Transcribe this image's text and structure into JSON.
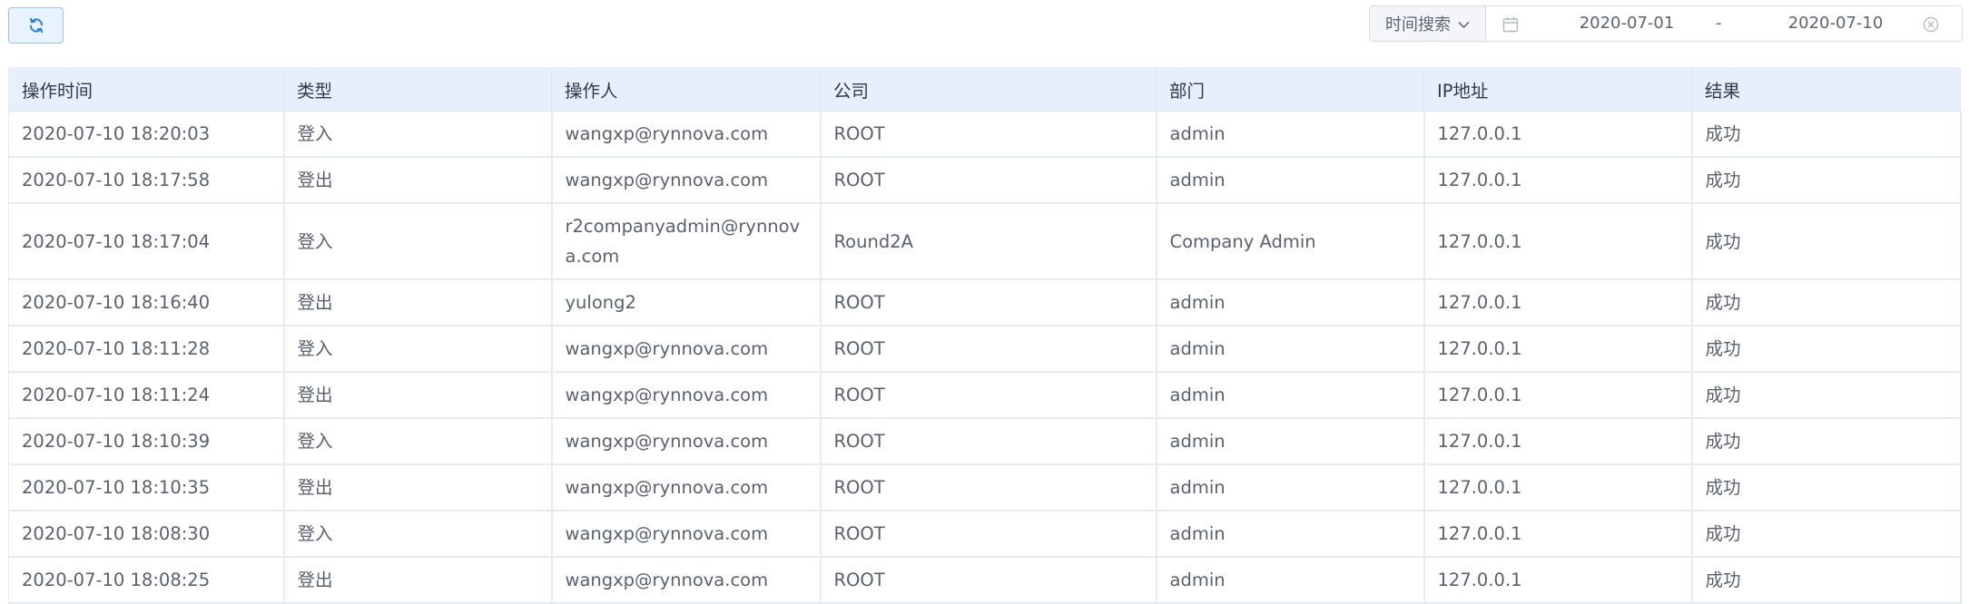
{
  "toolbar": {
    "refresh_icon": "refresh-icon",
    "search_type_label": "时间搜索",
    "date_start": "2020-07-01",
    "date_separator": "-",
    "date_end": "2020-07-10",
    "calendar_icon": "calendar-icon",
    "clear_icon": "circle-close-icon"
  },
  "table": {
    "columns": [
      "操作时间",
      "类型",
      "操作人",
      "公司",
      "部门",
      "IP地址",
      "结果"
    ],
    "rows": [
      [
        "2020-07-10 18:20:03",
        "登入",
        "wangxp@rynnova.com",
        "ROOT",
        "admin",
        "127.0.0.1",
        "成功"
      ],
      [
        "2020-07-10 18:17:58",
        "登出",
        "wangxp@rynnova.com",
        "ROOT",
        "admin",
        "127.0.0.1",
        "成功"
      ],
      [
        "2020-07-10 18:17:04",
        "登入",
        "r2companyadmin@rynnova.com",
        "Round2A",
        "Company Admin",
        "127.0.0.1",
        "成功"
      ],
      [
        "2020-07-10 18:16:40",
        "登出",
        "yulong2",
        "ROOT",
        "admin",
        "127.0.0.1",
        "成功"
      ],
      [
        "2020-07-10 18:11:28",
        "登入",
        "wangxp@rynnova.com",
        "ROOT",
        "admin",
        "127.0.0.1",
        "成功"
      ],
      [
        "2020-07-10 18:11:24",
        "登出",
        "wangxp@rynnova.com",
        "ROOT",
        "admin",
        "127.0.0.1",
        "成功"
      ],
      [
        "2020-07-10 18:10:39",
        "登入",
        "wangxp@rynnova.com",
        "ROOT",
        "admin",
        "127.0.0.1",
        "成功"
      ],
      [
        "2020-07-10 18:10:35",
        "登出",
        "wangxp@rynnova.com",
        "ROOT",
        "admin",
        "127.0.0.1",
        "成功"
      ],
      [
        "2020-07-10 18:08:30",
        "登入",
        "wangxp@rynnova.com",
        "ROOT",
        "admin",
        "127.0.0.1",
        "成功"
      ],
      [
        "2020-07-10 18:08:25",
        "登出",
        "wangxp@rynnova.com",
        "ROOT",
        "admin",
        "127.0.0.1",
        "成功"
      ]
    ]
  },
  "colors": {
    "accent": "#3a8ee6",
    "header_bg": "#e8effc",
    "button_bg": "#e9f3fd"
  }
}
